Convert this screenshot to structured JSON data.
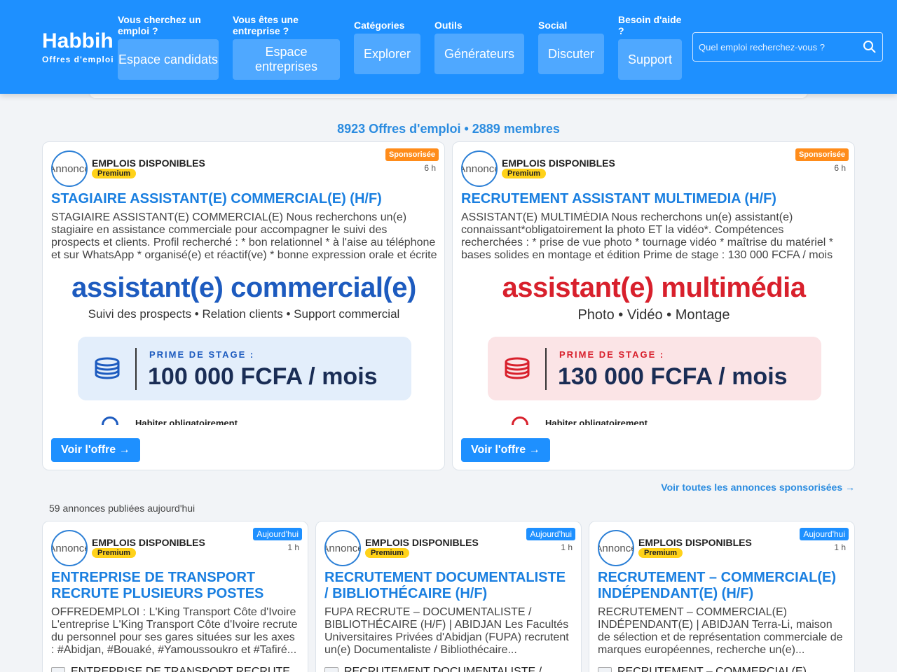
{
  "header": {
    "brand_name": "Habbih",
    "brand_tagline": "Offres d'emploi",
    "nav": [
      {
        "label": "Vous cherchez un emploi ?",
        "button": "Espace candidats ",
        "icon": "chevron-down-icon"
      },
      {
        "label": "Vous êtes une entreprise ?",
        "button": "Espace entreprises ",
        "icon": "chevron-down-icon"
      },
      {
        "label": "Catégories",
        "button": "Explorer ",
        "icon": "chevron-down-icon"
      },
      {
        "label": "Outils",
        "button": "Générateurs ",
        "icon": "chevron-down-icon"
      },
      {
        "label": "Social",
        "button": "Discuter ",
        "icon": "chevron-down-icon"
      },
      {
        "label": "Besoin d'aide ?",
        "button": "Support ",
        "icon": "chevron-down-icon"
      }
    ],
    "search_placeholder": "Quel emploi recherchez-vous ?"
  },
  "stats": "8923 Offres d'emploi • 2889 membres",
  "sponsored": [
    {
      "badge": "Sponsorisée",
      "time": "6 h",
      "avatar_alt": "Annonce",
      "company": "EMPLOIS DISPONIBLES",
      "tier": "Premium",
      "title": "STAGIAIRE ASSISTANT(E) COMMERCIAL(E) (H/F)",
      "description": "STAGIAIRE ASSISTANT(E) COMMERCIAL(E) Nous recherchons un(e) stagiaire en assistance commerciale pour accompagner le suivi des prospects et clients. Profil recherché : * bon relationnel * à l'aise au téléphone et sur WhatsApp * organisé(e) et réactif(ve) * bonne expression orale et écrite",
      "image": {
        "headline": "assistant(e) commercial(e)",
        "subline": "Suivi des prospects  •  Relation clients  •  Support commercial",
        "prime_label": "PRIME DE STAGE :",
        "amount": "100 000 FCFA / mois",
        "footer": "Habiter obligatoirement",
        "accent": "#1d5bbf",
        "box_color": "#e3eefb"
      },
      "cta": "Voir l'offre →"
    },
    {
      "badge": "Sponsorisée",
      "time": "6 h",
      "avatar_alt": "Annonce",
      "company": "EMPLOIS DISPONIBLES",
      "tier": "Premium",
      "title": "RECRUTEMENT ASSISTANT MULTIMEDIA (H/F)",
      "description": "ASSISTANT(E) MULTIMÉDIA Nous recherchons un(e) assistant(e) connaissant*obligatoirement la photo ET la vidéo*. Compétences recherchées : * prise de vue photo * tournage vidéo * maîtrise du matériel * bases solides en montage et édition  Prime de stage : 130 000 FCFA / mois",
      "image": {
        "headline": "assistant(e) multimédia",
        "subline": "Photo  •  Vidéo  •  Montage",
        "prime_label": "PRIME DE STAGE :",
        "amount": "130 000 FCFA / mois",
        "footer": "Habiter obligatoirement",
        "accent": "#d8202c",
        "box_color": "#fbe4e6"
      },
      "cta": "Voir l'offre →"
    }
  ],
  "see_all_sponsored": "Voir toutes les annonces sponsorisées →",
  "today_count": "59 annonces publiées aujourd'hui",
  "today": [
    {
      "badge": "Aujourd'hui",
      "time": "1 h",
      "avatar_alt": "Annonce",
      "company": "EMPLOIS DISPONIBLES",
      "tier": "Premium",
      "title": "ENTREPRISE DE TRANSPORT RECRUTE PLUSIEURS POSTES",
      "description": "OFFREDEMPLOI : L'King Transport Côte d'Ivoire L'entreprise L'King Transport Côte d'Ivoire recrute du personnel pour ses gares situées sur les axes : #Abidjan, #Bouaké, #Yamoussoukro et #Tafiré...",
      "thumb_caption": "ENTREPRISE DE TRANSPORT RECRUTE"
    },
    {
      "badge": "Aujourd'hui",
      "time": "1 h",
      "avatar_alt": "Annonce",
      "company": "EMPLOIS DISPONIBLES",
      "tier": "Premium",
      "title": "RECRUTEMENT DOCUMENTALISTE / BIBLIOTHÉCAIRE (H/F)",
      "description": " FUPA RECRUTE – DOCUMENTALISTE / BIBLIOTHÉCAIRE (H/F) | ABIDJAN  Les Facultés Universitaires Privées d'Abidjan (FUPA) recrutent un(e) Documentaliste / Bibliothécaire...",
      "thumb_caption": "RECRUTEMENT DOCUMENTALISTE /"
    },
    {
      "badge": "Aujourd'hui",
      "time": "1 h",
      "avatar_alt": "Annonce",
      "company": "EMPLOIS DISPONIBLES",
      "tier": "Premium",
      "title": "RECRUTEMENT – COMMERCIAL(E) INDÉPENDANT(E) (H/F)",
      "description": " RECRUTEMENT – COMMERCIAL(E) INDÉPENDANT(E) | ABIDJAN  Terra-Li, maison de sélection et de représentation commerciale de marques européennes, recherche un(e)...",
      "thumb_caption": "RECRUTEMENT – COMMERCIAL(E)"
    }
  ]
}
